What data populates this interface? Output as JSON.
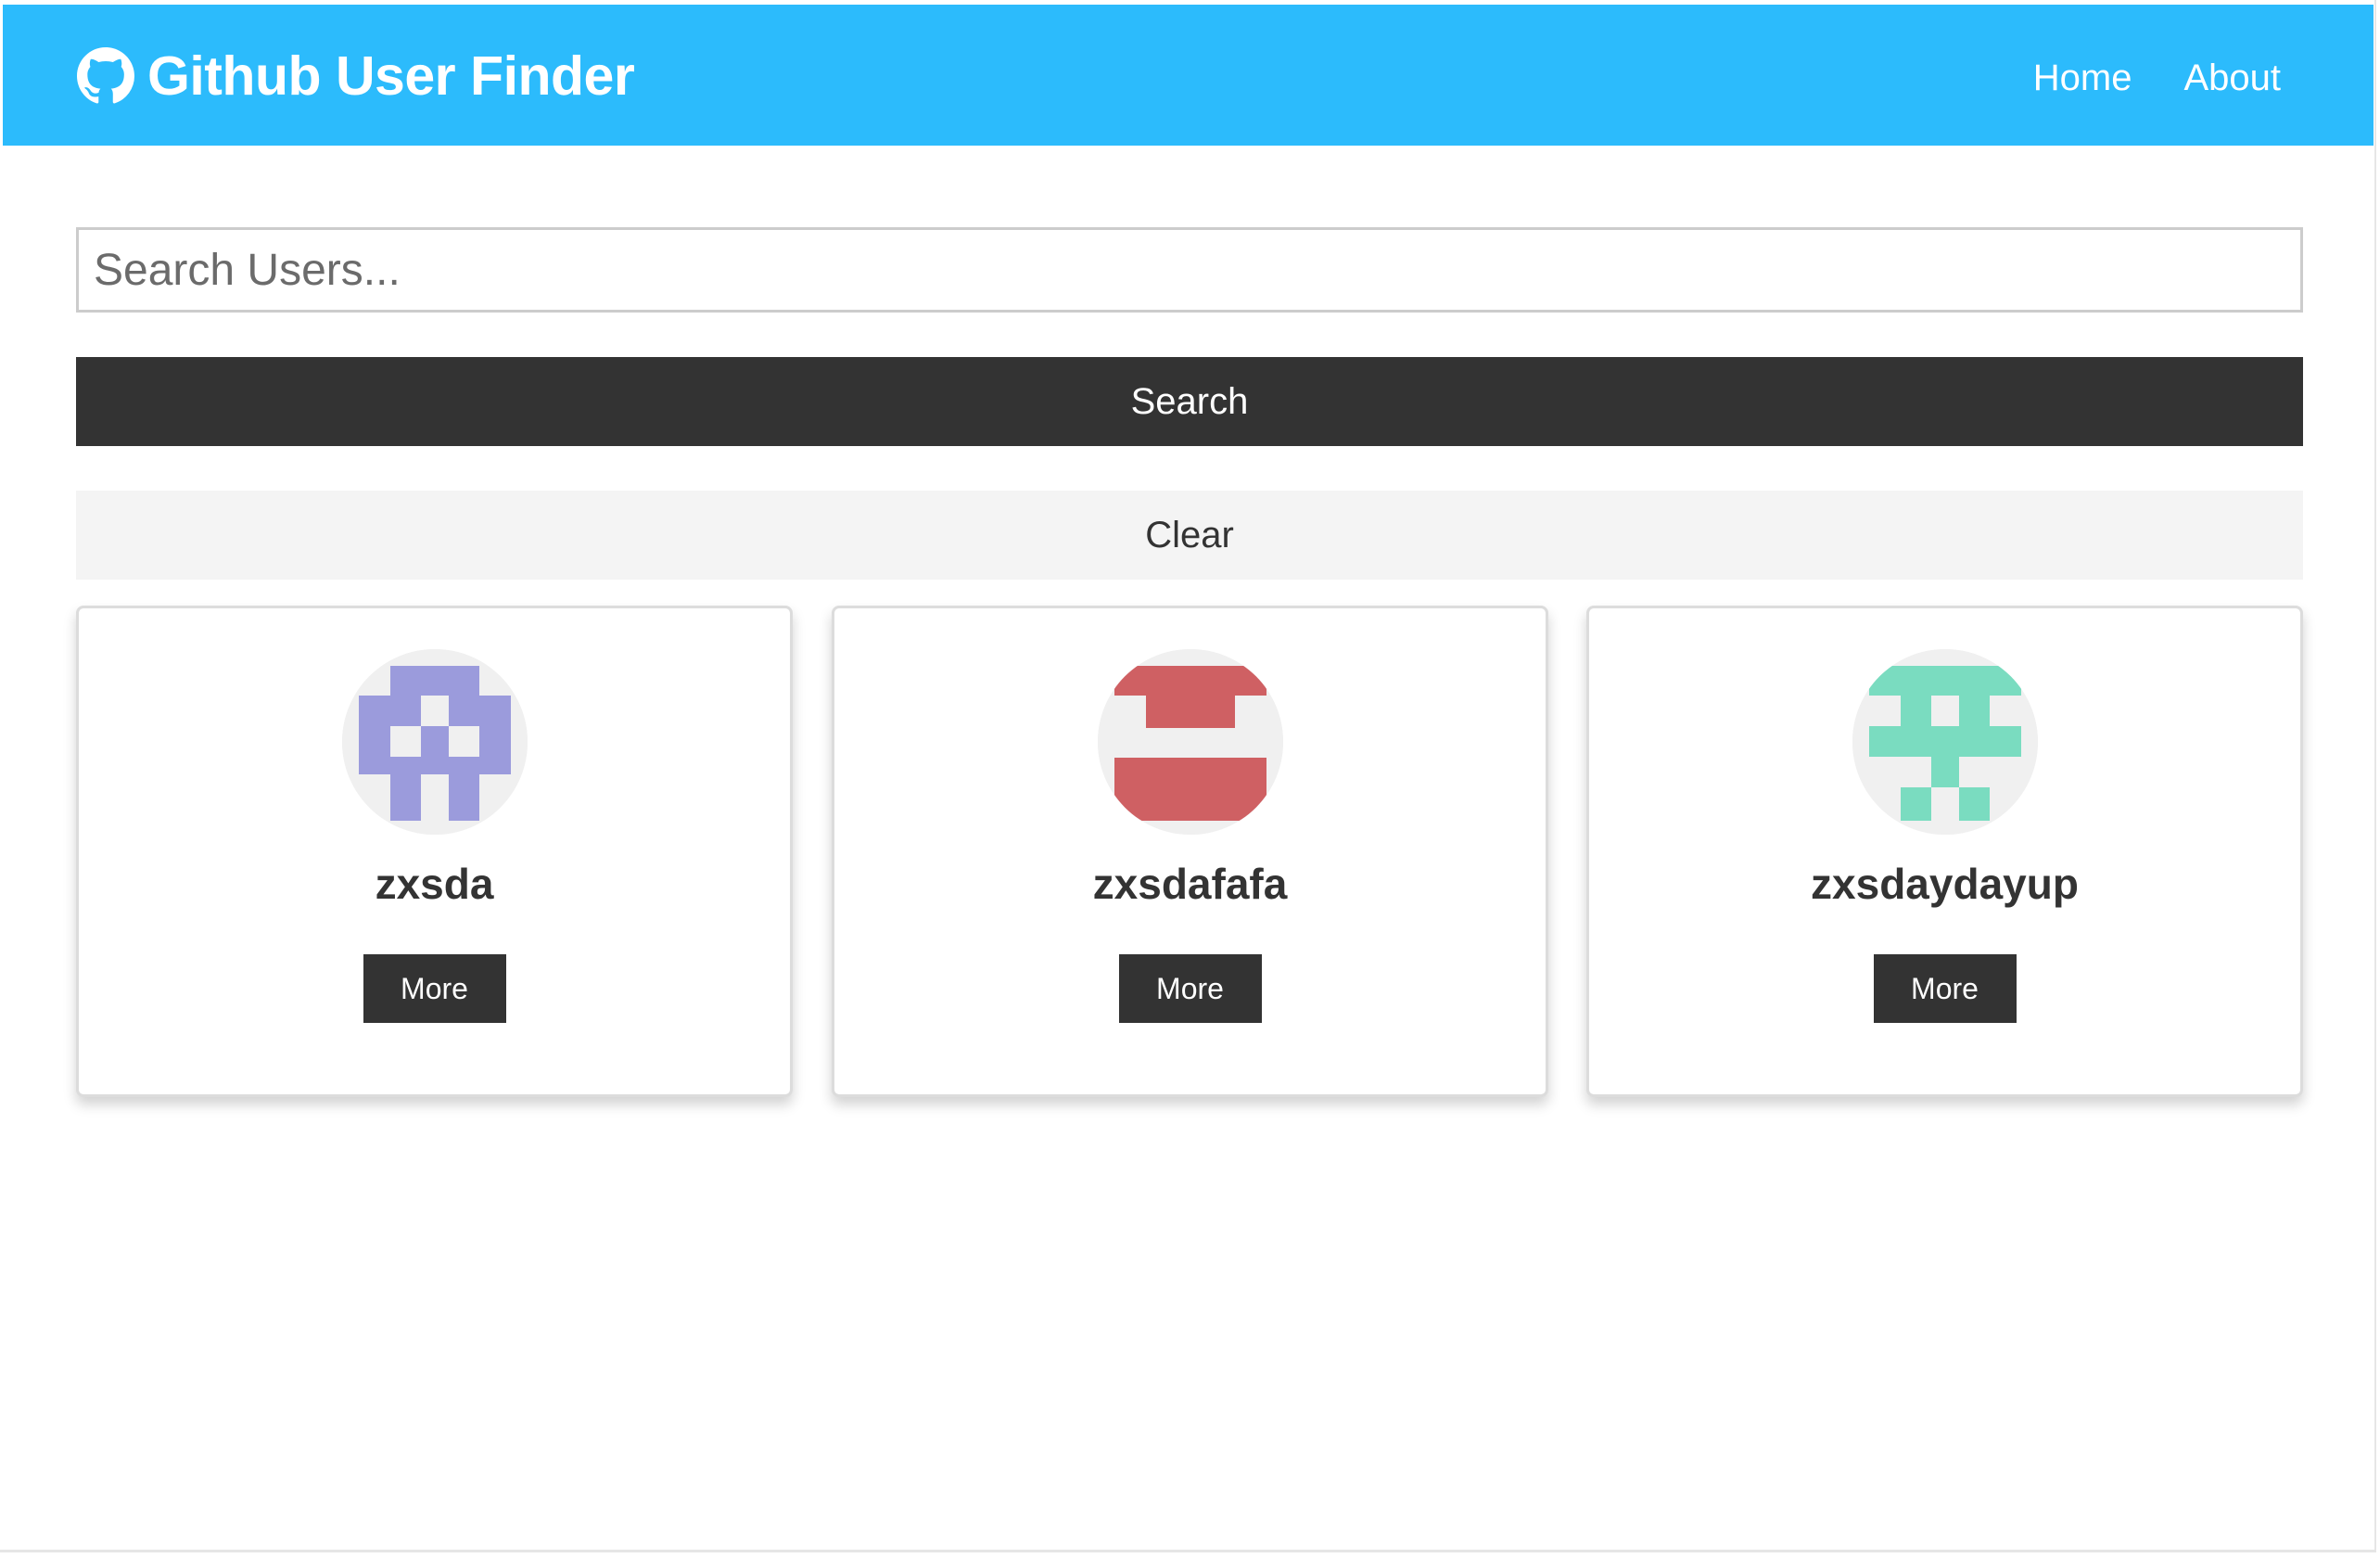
{
  "colors": {
    "navbar": "#2cbbfc",
    "dark": "#333333",
    "light": "#f4f4f4"
  },
  "navbar": {
    "title": "Github User Finder",
    "icon": "github-icon",
    "links": [
      {
        "label": "Home"
      },
      {
        "label": "About"
      }
    ]
  },
  "search": {
    "placeholder": "Search Users...",
    "value": "",
    "search_label": "Search",
    "clear_label": "Clear"
  },
  "users": [
    {
      "login": "zxsda",
      "more_label": "More",
      "avatar_color": "#9b9bdc"
    },
    {
      "login": "zxsdafafa",
      "more_label": "More",
      "avatar_color": "#cf6063"
    },
    {
      "login": "zxsdaydayup",
      "more_label": "More",
      "avatar_color": "#7adcc0"
    }
  ]
}
